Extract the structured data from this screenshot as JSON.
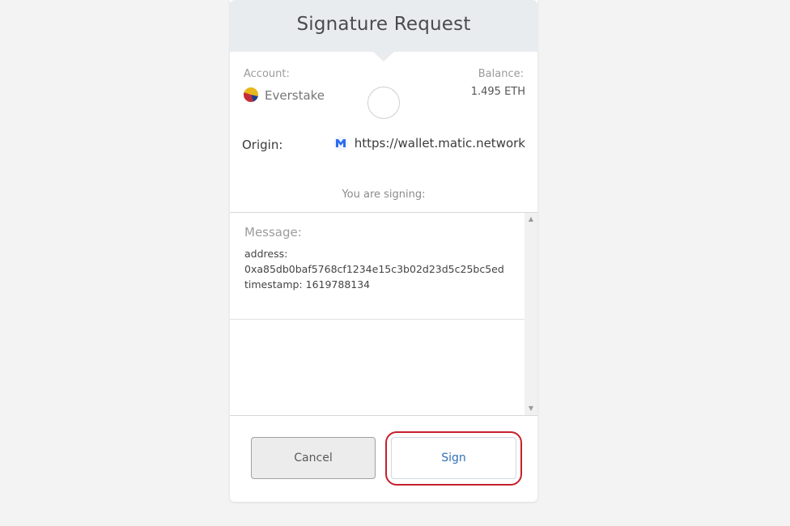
{
  "header": {
    "title": "Signature Request"
  },
  "account": {
    "label": "Account:",
    "name": "Everstake",
    "identicon_colors": [
      "#e8b71b",
      "#c62a3a",
      "#1e3d8f"
    ]
  },
  "balance": {
    "label": "Balance:",
    "value": "1.495 ETH"
  },
  "origin": {
    "label": "Origin:",
    "icon": "matic-logo-icon",
    "url": "https://wallet.matic.network"
  },
  "signing": {
    "label": "You are signing:"
  },
  "message": {
    "title": "Message:",
    "address_line": "address:",
    "address_value": "0xa85db0baf5768cf1234e15c3b02d23d5c25bc5ed",
    "timestamp_line": "timestamp: 1619788134"
  },
  "actions": {
    "cancel_label": "Cancel",
    "sign_label": "Sign"
  },
  "colors": {
    "header_bg": "#e9ecef",
    "sign_text": "#2f72b8",
    "highlight": "#c6202c"
  }
}
